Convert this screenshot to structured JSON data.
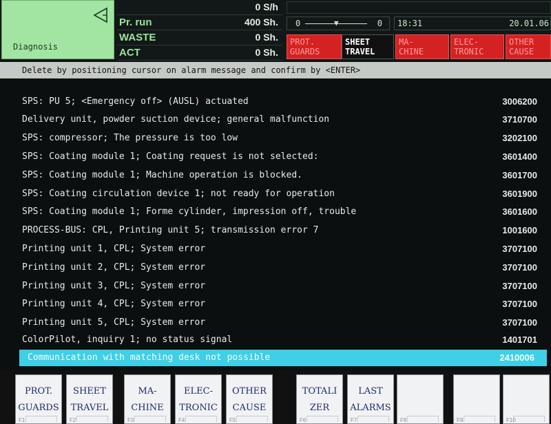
{
  "diagnosis": {
    "label": "Diagnosis"
  },
  "counters": [
    {
      "key": "",
      "value": "0 S/h"
    },
    {
      "key": "Pr. run",
      "value": "400 Sh."
    },
    {
      "key": "WASTE",
      "value": "0 Sh."
    },
    {
      "key": "ACT",
      "value": "0 Sh."
    }
  ],
  "slider": {
    "min": "0",
    "max": "0"
  },
  "clock": {
    "time": "18:31",
    "date": "20.01.06"
  },
  "categories": [
    {
      "l1": "PROT.",
      "l2": "GUARDS",
      "active": false
    },
    {
      "l1": "SHEET",
      "l2": "TRAVEL",
      "active": true
    },
    {
      "l1": "MA-",
      "l2": "CHINE",
      "active": false
    },
    {
      "l1": "ELEC-",
      "l2": "TRONIC",
      "active": false
    },
    {
      "l1": "OTHER",
      "l2": "CAUSE",
      "active": false
    }
  ],
  "instruction": "Delete by positioning cursor on alarm message and confirm by <ENTER>",
  "alarms": [
    {
      "msg": "SPS: PU 5; <Emergency off> (AUSL) actuated",
      "code": "3006200"
    },
    {
      "msg": "Delivery unit, powder suction device; general malfunction",
      "code": "3710700"
    },
    {
      "msg": "SPS: compressor; The pressure is too low",
      "code": "3202100"
    },
    {
      "msg": "SPS: Coating module 1; Coating request is not selected:",
      "code": "3601400"
    },
    {
      "msg": "SPS: Coating module 1; Machine operation is blocked.",
      "code": "3601700"
    },
    {
      "msg": "SPS: Coating circulation device 1; not ready for operation",
      "code": "3601900"
    },
    {
      "msg": "SPS: Coating module 1; Forme cylinder, impression off, trouble",
      "code": "3601600"
    },
    {
      "msg": "PROCESS-BUS: CPL, Printing unit 5; transmission error 7",
      "code": "1001600"
    },
    {
      "msg": "Printing unit 1, CPL; System error",
      "code": "3707100"
    },
    {
      "msg": "Printing unit 2, CPL; System error",
      "code": "3707100"
    },
    {
      "msg": "Printing unit 3, CPL; System error",
      "code": "3707100"
    },
    {
      "msg": "Printing unit 4, CPL; System error",
      "code": "3707100"
    },
    {
      "msg": "Printing unit 5, CPL; System error",
      "code": "3707100"
    },
    {
      "msg": "ColorPilot, inquiry 1; no status signal",
      "code": "1401701"
    },
    {
      "msg": "Communication with matching desk not possible",
      "code": "2410006"
    }
  ],
  "selected_alarm_index": 14,
  "softkeys": [
    {
      "l1": "PROT.",
      "l2": "GUARDS",
      "fn": "F1"
    },
    {
      "l1": "SHEET",
      "l2": "TRAVEL",
      "fn": "F2"
    },
    {
      "l1": "MA-",
      "l2": "CHINE",
      "fn": "F3"
    },
    {
      "l1": "ELEC-",
      "l2": "TRONIC",
      "fn": "F4"
    },
    {
      "l1": "OTHER",
      "l2": "CAUSE",
      "fn": "F5"
    },
    {
      "l1": "TOTALI",
      "l2": "ZER",
      "fn": "F6"
    },
    {
      "l1": "LAST",
      "l2": "ALARMS",
      "fn": "F7"
    },
    {
      "l1": "",
      "l2": "",
      "fn": "F8"
    },
    {
      "l1": "",
      "l2": "",
      "fn": "F9"
    },
    {
      "l1": "",
      "l2": "",
      "fn": "F10"
    }
  ],
  "colors": {
    "diagnosis_bg": "#a2e5a2",
    "category_red": "#d42222",
    "selection_cyan": "#3fcfe6"
  }
}
